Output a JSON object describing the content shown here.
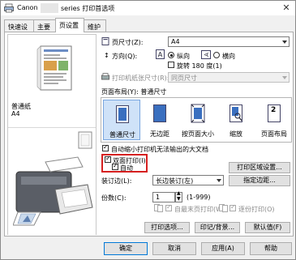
{
  "window": {
    "title_prefix": "Canon",
    "title_suffix": "series 打印首选项"
  },
  "tabs": [
    {
      "label": "快速设置"
    },
    {
      "label": "主要"
    },
    {
      "label": "页设置"
    },
    {
      "label": "维护"
    }
  ],
  "preview": {
    "media_line1": "普通纸",
    "media_line2": "A4"
  },
  "page_size": {
    "label": "页尺寸(Z):",
    "value": "A4"
  },
  "orientation": {
    "label": "方向(Q):",
    "portrait": "纵向",
    "landscape": "横向",
    "rotate": "旋转 180 度(1)"
  },
  "printer_paper": {
    "label": "打印机纸张尺寸(R):",
    "value": "同页尺寸"
  },
  "page_layout": {
    "label": "页面布局(Y): 普通尺寸",
    "items": [
      {
        "label": "普通尺寸"
      },
      {
        "label": "无边距"
      },
      {
        "label": "按页面大小"
      },
      {
        "label": "缩放"
      },
      {
        "label": "页面布局"
      }
    ],
    "layout_badge": "2"
  },
  "auto_reduce": {
    "label": "自动缩小打印机无法输出的大文档"
  },
  "duplex": {
    "label": "双面打印(I)",
    "auto_label": "自动",
    "area_button": "打印区域设置..."
  },
  "staple": {
    "label": "装订边(L):",
    "value": "长边装订(左)",
    "margin_button": "指定边距..."
  },
  "copies": {
    "label": "份数(C):",
    "value": "1",
    "range": "(1-999)",
    "reverse": "自最末页打印(W)",
    "collate": "逐份打印(O)"
  },
  "buttons": {
    "print_options": "打印选项...",
    "stamp": "印记/背景...",
    "defaults": "默认值(F)",
    "ok": "确定",
    "cancel": "取消",
    "apply": "应用(A)",
    "help": "帮助"
  }
}
